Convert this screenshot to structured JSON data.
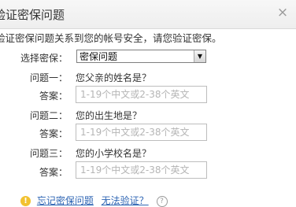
{
  "dialog": {
    "title": "验证密保问题",
    "close_glyph": "×",
    "intro": "验证密保问题关系到您的帐号安全，请您验证密保。"
  },
  "form": {
    "select_label": "选择密保：",
    "select_value": "密保问题",
    "questions": [
      {
        "label": "问题一：",
        "text": "您父亲的姓名是？",
        "answer_label": "答案：",
        "placeholder": "1-19个中文或2-38个英文"
      },
      {
        "label": "问题二：",
        "text": "您的出生地是？",
        "answer_label": "答案：",
        "placeholder": "1-19个中文或2-38个英文"
      },
      {
        "label": "问题三：",
        "text": "您的小学校名是？",
        "answer_label": "答案：",
        "placeholder": "1-19个中文或2-38个英文"
      }
    ]
  },
  "footer": {
    "icon": "warning-icon",
    "forgot_link": "忘记密保问题",
    "cannot_verify_link": "无法验证？",
    "help_icon": "help-icon"
  },
  "colors": {
    "link": "#2d64b3",
    "warning": "#f2c230",
    "placeholder": "#b5b5b5"
  }
}
